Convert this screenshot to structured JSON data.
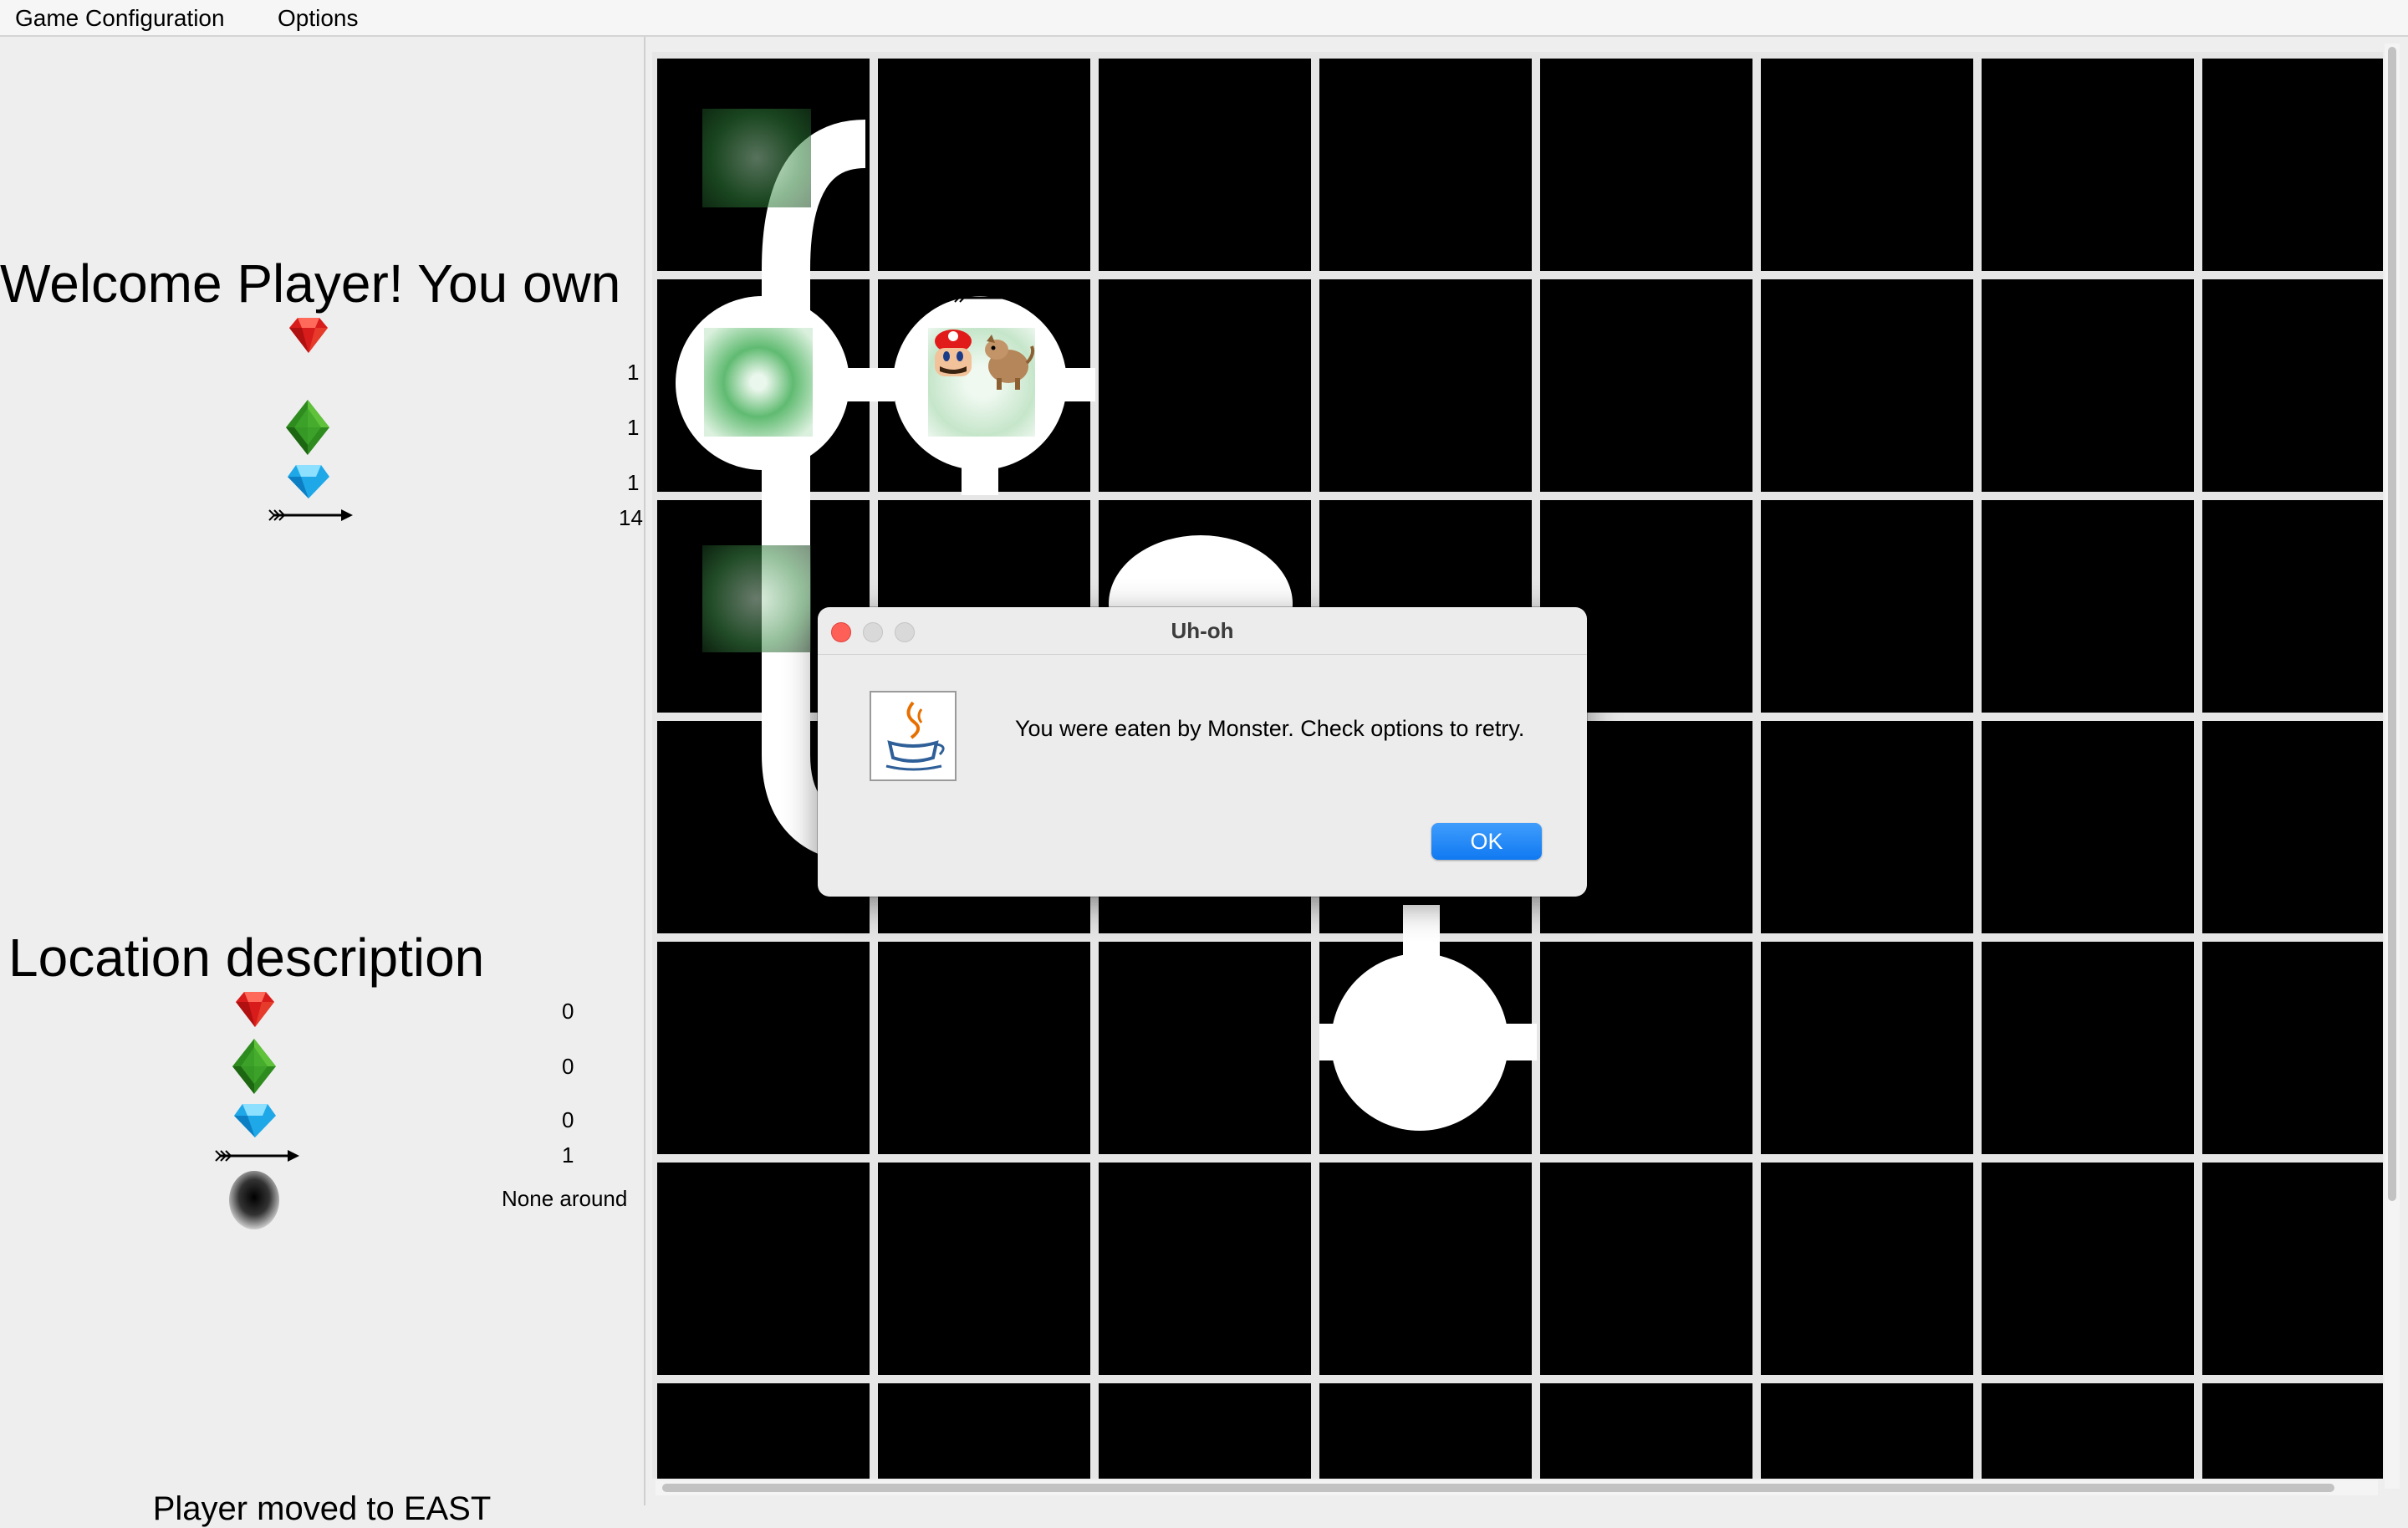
{
  "menu": {
    "items": [
      "Game Configuration",
      "Options"
    ]
  },
  "player_panel": {
    "heading": "Welcome Player! You own",
    "ruby_count": "1",
    "emerald_count": "1",
    "diamond_count": "1",
    "arrow_count": "14"
  },
  "location_panel": {
    "heading": "Location description",
    "ruby_count": "0",
    "emerald_count": "0",
    "diamond_count": "0",
    "arrow_count": "1",
    "smell_status": "None around"
  },
  "status": {
    "message": "Player moved to EAST"
  },
  "board": {
    "columns": 8,
    "rows_visible": 7
  },
  "dialog": {
    "title": "Uh-oh",
    "message": "You were eaten by Monster. Check options to retry.",
    "ok_label": "OK"
  },
  "icons": {
    "ruby": "ruby-gem-icon",
    "emerald": "emerald-gem-icon",
    "diamond": "diamond-gem-icon",
    "arrow": "arrow-icon",
    "smell": "smell-pit-icon",
    "player": "player-mario-icon",
    "monster": "monster-icon",
    "dialog": "java-coffee-icon"
  },
  "colors": {
    "ok_button": "#1a84f5",
    "close_dot": "#fe5f57",
    "board_background": "#000000"
  }
}
